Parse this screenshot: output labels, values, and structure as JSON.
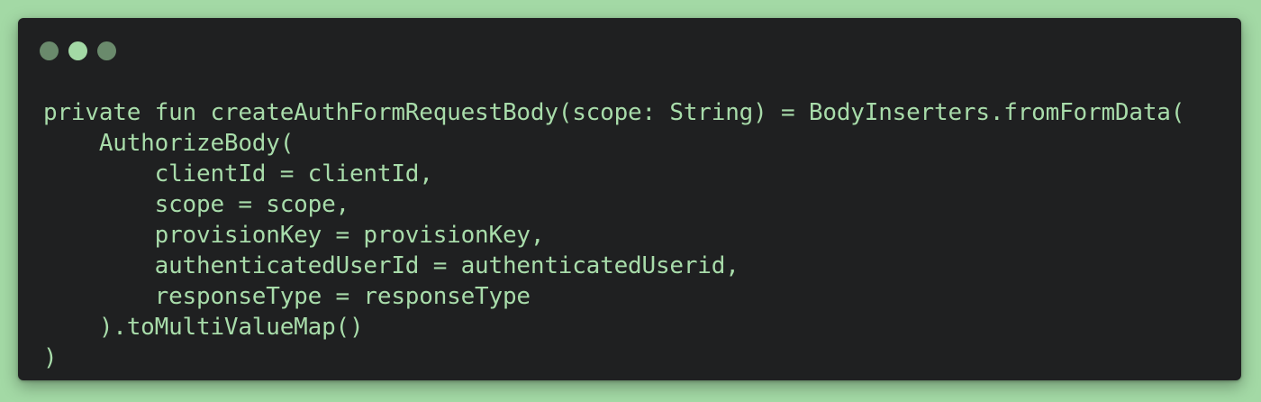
{
  "window": {
    "traffic_lights": [
      {
        "name": "close",
        "color": "#6a8a6c"
      },
      {
        "name": "minimize",
        "color": "#a3d9a5"
      },
      {
        "name": "maximize",
        "color": "#6a8a6c"
      }
    ],
    "background": "#1f2021",
    "text_color": "#a8dcaa"
  },
  "page_background": "#a3d9a5",
  "code": {
    "language": "kotlin",
    "lines": [
      "private fun createAuthFormRequestBody(scope: String) = BodyInserters.fromFormData(",
      "    AuthorizeBody(",
      "        clientId = clientId,",
      "        scope = scope,",
      "        provisionKey = provisionKey,",
      "        authenticatedUserId = authenticatedUserid,",
      "        responseType = responseType",
      "    ).toMultiValueMap()",
      ")"
    ]
  }
}
